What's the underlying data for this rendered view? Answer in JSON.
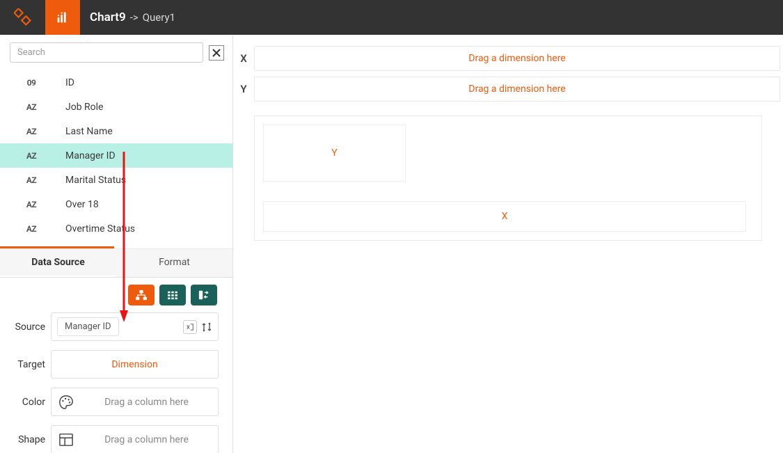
{
  "header": {
    "chart_name": "Chart9",
    "arrow": "->",
    "query_name": "Query1"
  },
  "sidebar": {
    "search_placeholder": "Search",
    "fields": [
      {
        "type": "09",
        "name": "ID"
      },
      {
        "type": "AZ",
        "name": "Job Role"
      },
      {
        "type": "AZ",
        "name": "Last Name"
      },
      {
        "type": "AZ",
        "name": "Manager ID"
      },
      {
        "type": "AZ",
        "name": "Marital Status"
      },
      {
        "type": "AZ",
        "name": "Over 18"
      },
      {
        "type": "AZ",
        "name": "Overtime Status"
      }
    ],
    "selected_index": 3,
    "tabs": {
      "data_source": "Data Source",
      "format": "Format",
      "active": "data_source"
    },
    "form": {
      "source_label": "Source",
      "source_value": "Manager ID",
      "target_label": "Target",
      "target_placeholder": "Dimension",
      "color_label": "Color",
      "color_placeholder": "Drag a column here",
      "shape_label": "Shape",
      "shape_placeholder": "Drag a column here"
    }
  },
  "content": {
    "x_label": "X",
    "y_label": "Y",
    "drop_placeholder": "Drag a dimension here",
    "preview_x": "X",
    "preview_y": "Y"
  }
}
